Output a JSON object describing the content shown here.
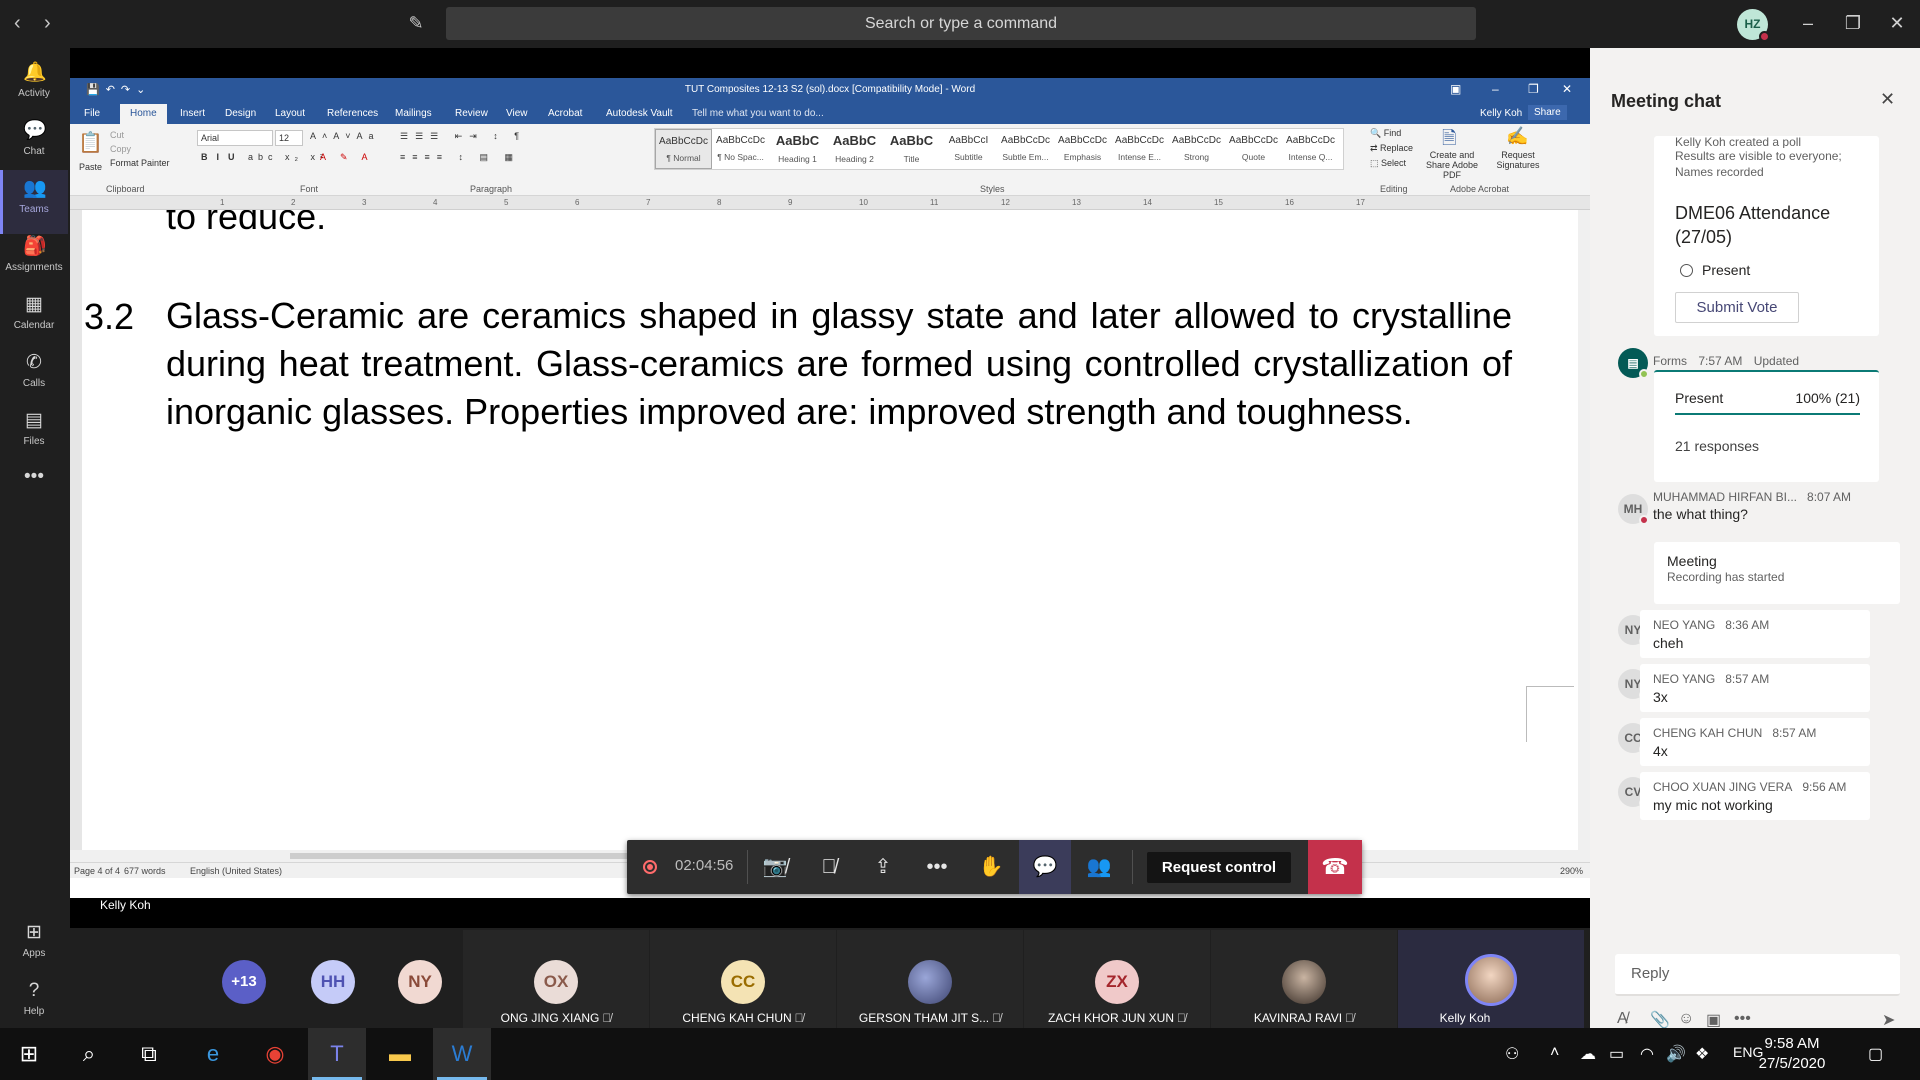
{
  "teams": {
    "search_placeholder": "Search or type a command",
    "user_initials": "HZ",
    "rail": [
      {
        "label": "Activity",
        "icon": "bell-icon"
      },
      {
        "label": "Chat",
        "icon": "chat-icon"
      },
      {
        "label": "Teams",
        "icon": "teams-icon"
      },
      {
        "label": "Assignments",
        "icon": "assignments-icon"
      },
      {
        "label": "Calendar",
        "icon": "calendar-icon"
      },
      {
        "label": "Calls",
        "icon": "phone-icon"
      },
      {
        "label": "Files",
        "icon": "files-icon"
      },
      {
        "label": "Apps",
        "icon": "apps-icon"
      },
      {
        "label": "Help",
        "icon": "help-icon"
      }
    ]
  },
  "word": {
    "title": "TUT Composites 12-13 S2 (sol).docx [Compatibility Mode] - Word",
    "tabs": [
      "File",
      "Home",
      "Insert",
      "Design",
      "Layout",
      "References",
      "Mailings",
      "Review",
      "View",
      "Acrobat",
      "Autodesk Vault"
    ],
    "tell_me": "Tell me what you want to do...",
    "user": "Kelly Koh",
    "share": "Share",
    "clipboard": {
      "paste": "Paste",
      "cut": "Cut",
      "copy": "Copy",
      "format_painter": "Format Painter",
      "label": "Clipboard"
    },
    "font": {
      "name": "Arial",
      "size": "12",
      "label": "Font"
    },
    "paragraph_label": "Paragraph",
    "styles": [
      {
        "sample": "AaBbCcDc",
        "name": "¶ Normal"
      },
      {
        "sample": "AaBbCcDc",
        "name": "¶ No Spac..."
      },
      {
        "sample": "AaBbC",
        "name": "Heading 1"
      },
      {
        "sample": "AaBbC",
        "name": "Heading 2"
      },
      {
        "sample": "AaBbC",
        "name": "Title"
      },
      {
        "sample": "AaBbCcI",
        "name": "Subtitle"
      },
      {
        "sample": "AaBbCcDc",
        "name": "Subtle Em..."
      },
      {
        "sample": "AaBbCcDc",
        "name": "Emphasis"
      },
      {
        "sample": "AaBbCcDc",
        "name": "Intense E..."
      },
      {
        "sample": "AaBbCcDc",
        "name": "Strong"
      },
      {
        "sample": "AaBbCcDc",
        "name": "Quote"
      },
      {
        "sample": "AaBbCcDc",
        "name": "Intense Q..."
      }
    ],
    "styles_label": "Styles",
    "editing": {
      "find": "Find",
      "replace": "Replace",
      "select": "Select",
      "label": "Editing"
    },
    "acrobat": {
      "create": "Create and Share Adobe PDF",
      "request": "Request Signatures",
      "label": "Adobe Acrobat"
    },
    "ruler": [
      "1",
      "2",
      "3",
      "4",
      "5",
      "6",
      "7",
      "8",
      "9",
      "10",
      "11",
      "12",
      "13",
      "14",
      "15",
      "16",
      "17"
    ],
    "doc": {
      "cut_line": "to reduce.",
      "section_number": "3.2",
      "paragraph": "Glass-Ceramic are ceramics shaped in glassy state and later allowed to crystalline during heat treatment. Glass-ceramics are formed using controlled crystallization of inorganic glasses. Properties improved are: improved strength and toughness."
    },
    "status": {
      "page": "Page 4 of 4",
      "words": "677 words",
      "language": "English (United States)",
      "zoom": "290%"
    }
  },
  "sharer_label": "Kelly Koh",
  "controls": {
    "timer": "02:04:56",
    "request_control": "Request control"
  },
  "participants": {
    "overflow": "+13",
    "mini": [
      {
        "initials": "HH",
        "bg": "#c5cbf8",
        "fg": "#4f52b2"
      },
      {
        "initials": "NY",
        "bg": "#f1d9d2",
        "fg": "#8a4a39"
      }
    ],
    "tiles": [
      {
        "initials": "OX",
        "name": "ONG JING XIANG",
        "bg": "#eadcd7",
        "fg": "#8a5a4b"
      },
      {
        "initials": "CC",
        "name": "CHENG KAH CHUN",
        "bg": "#f4e3b4",
        "fg": "#9a6c00"
      },
      {
        "initials": "",
        "name": "GERSON THAM JIT S...",
        "bg": "#4a5680",
        "fg": "#ffffff"
      },
      {
        "initials": "ZX",
        "name": "ZACH KHOR JUN XUN",
        "bg": "#f0c9c9",
        "fg": "#a4262c"
      },
      {
        "initials": "",
        "name": "KAVINRAJ RAVI",
        "bg": "#6b5a4e",
        "fg": "#ffffff"
      },
      {
        "initials": "",
        "name": "Kelly Koh",
        "bg": "#c9d6ee",
        "fg": "#2b579a"
      }
    ]
  },
  "chat": {
    "title": "Meeting chat",
    "poll_intro_cut": "Kelly Koh created a poll",
    "poll_visibility": "Results are visible to everyone; Names recorded",
    "poll_title": "DME06 Attendance (27/05)",
    "poll_option": "Present",
    "submit_vote": "Submit Vote",
    "forms_sender": "Forms",
    "forms_time": "7:57 AM",
    "forms_status": "Updated",
    "result_option": "Present",
    "result_value": "100% (21)",
    "result_fraction": 1.0,
    "responses": "21 responses",
    "messages": [
      {
        "initials": "MH",
        "name": "MUHAMMAD HIRFAN BI...",
        "time": "8:07 AM",
        "text": "the what thing?"
      },
      {
        "initials": "NY",
        "name": "NEO YANG",
        "time": "8:36 AM",
        "text": "cheh"
      },
      {
        "initials": "NY",
        "name": "NEO YANG",
        "time": "8:57 AM",
        "text": "3x"
      },
      {
        "initials": "CC",
        "name": "CHENG KAH CHUN",
        "time": "8:57 AM",
        "text": "4x"
      },
      {
        "initials": "CV",
        "name": "CHOO XUAN JING VERA",
        "time": "9:56 AM",
        "text": "my mic not working"
      }
    ],
    "system_title": "Meeting",
    "system_text": "Recording has started",
    "reply_placeholder": "Reply"
  },
  "taskbar": {
    "language": "ENG",
    "time": "9:58 AM",
    "date": "27/5/2020"
  }
}
